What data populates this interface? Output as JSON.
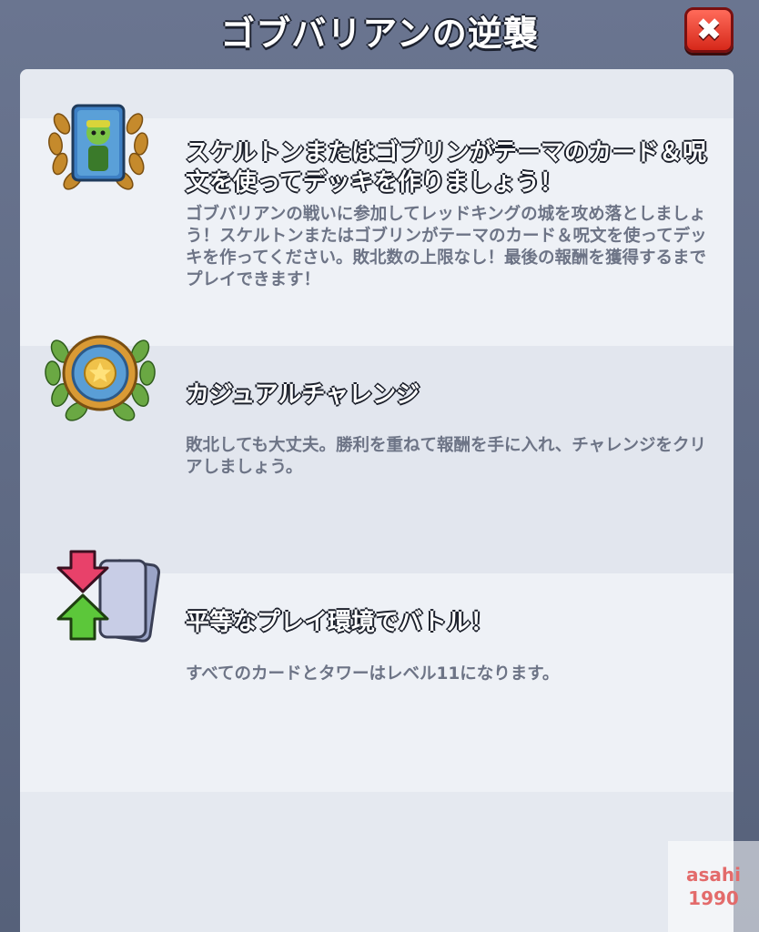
{
  "header": {
    "title": "ゴブバリアンの逆襲",
    "close_glyph": "✖",
    "close_icon": "close-icon"
  },
  "sections": [
    {
      "icon": "goblin-card-laurel-icon",
      "heading": "スケルトンまたはゴブリンがテーマのカード＆呪文を使ってデッキを作りましょう！",
      "description": "ゴブバリアンの戦いに参加してレッドキングの城を攻め落としましょう！スケルトンまたはゴブリンがテーマのカード＆呪文を使ってデッキを作ってください。敗北数の上限なし！最後の報酬を獲得するまでプレイできます！"
    },
    {
      "icon": "star-medal-laurel-icon",
      "heading": "カジュアルチャレンジ",
      "description": "敗北しても大丈夫。勝利を重ねて報酬を手に入れ、チャレンジをクリアしましょう。"
    },
    {
      "icon": "level-up-down-cards-icon",
      "heading": "平等なプレイ環境でバトル！",
      "description": "すべてのカードとタワーはレベル11になります。"
    }
  ],
  "watermark": {
    "line1": "asahi",
    "line2": "1990"
  },
  "colors": {
    "frame": "#5b6781",
    "panel": "#e5e9f0",
    "close_button": "#e0382a",
    "description_text": "#6d7486"
  }
}
